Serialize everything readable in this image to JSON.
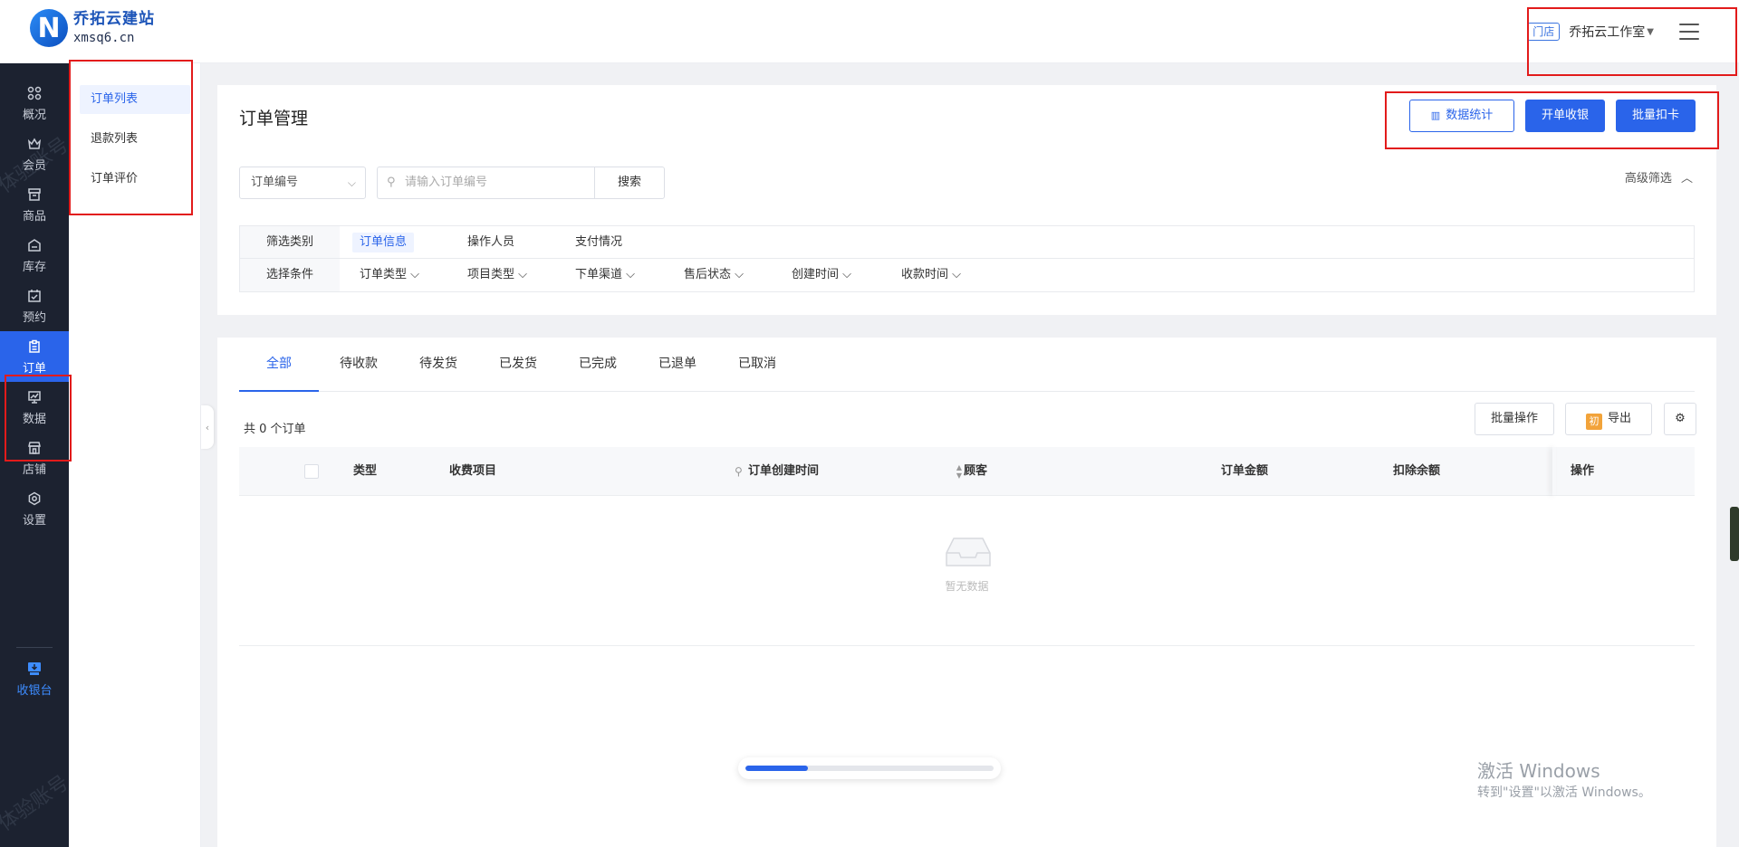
{
  "brand": {
    "name": "乔拓云建站",
    "domain": "xmsq6.cn",
    "logo_letter": "N"
  },
  "header": {
    "store_tag": "门店",
    "store_name": "乔拓云工作室"
  },
  "leftnav": {
    "items": [
      {
        "label": "概况",
        "icon": "grid-icon"
      },
      {
        "label": "会员",
        "icon": "crown-icon"
      },
      {
        "label": "商品",
        "icon": "shop-box-icon"
      },
      {
        "label": "库存",
        "icon": "warehouse-icon"
      },
      {
        "label": "预约",
        "icon": "calendar-check-icon"
      },
      {
        "label": "订单",
        "icon": "clipboard-icon"
      },
      {
        "label": "数据",
        "icon": "chart-monitor-icon"
      },
      {
        "label": "店铺",
        "icon": "storefront-icon"
      },
      {
        "label": "设置",
        "icon": "gear-icon"
      },
      {
        "label": "收银台",
        "icon": "cashier-icon"
      }
    ],
    "active": "订单"
  },
  "subnav": {
    "items": [
      "订单列表",
      "退款列表",
      "订单评价"
    ],
    "active": "订单列表"
  },
  "main": {
    "title": "订单管理",
    "buttons": {
      "stats": "数据统计",
      "open_cashier": "开单收银",
      "batch_deduct": "批量扣卡"
    },
    "search": {
      "field_select": "订单编号",
      "placeholder": "请输入订单编号",
      "button": "搜索"
    },
    "advanced_filter": "高级筛选",
    "filter": {
      "category_label": "筛选类别",
      "categories": [
        "订单信息",
        "操作人员",
        "支付情况"
      ],
      "active_category": "订单信息",
      "condition_label": "选择条件",
      "conditions": [
        "订单类型",
        "项目类型",
        "下单渠道",
        "售后状态",
        "创建时间",
        "收款时间"
      ]
    }
  },
  "orders": {
    "tabs": [
      "全部",
      "待收款",
      "待发货",
      "已发货",
      "已完成",
      "已退单",
      "已取消"
    ],
    "active_tab": "全部",
    "count_text": "共 0 个订单",
    "toolbar": {
      "batch_op": "批量操作",
      "export_badge": "初",
      "export": "导出"
    },
    "columns": [
      "类型",
      "收费项目",
      "订单创建时间",
      "顾客",
      "订单金额",
      "扣除余额",
      "操作"
    ],
    "empty_text": "暂无数据"
  },
  "progress": {
    "value": 0.25,
    "color": "#2a64ea"
  },
  "windows_activation": {
    "line1": "激活 Windows",
    "line2": "转到\"设置\"以激活 Windows。"
  },
  "watermark": {
    "text": "体验账号"
  },
  "colors": {
    "primary": "#2a64ea",
    "nav_bg": "#1c2230",
    "highlight": "#e21b1b"
  }
}
